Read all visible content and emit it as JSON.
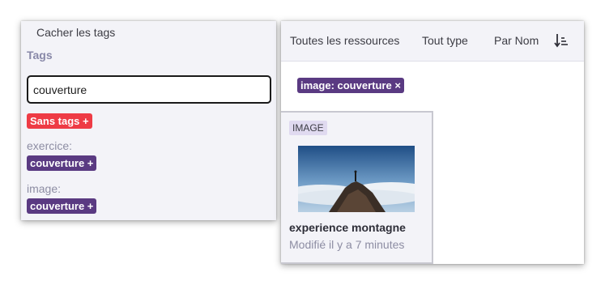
{
  "left_panel": {
    "hide_tags_label": "Cacher les tags",
    "tags_title": "Tags",
    "search_value": "couverture",
    "no_tags_label": "Sans tags +",
    "groups": [
      {
        "category": "exercice:",
        "tag": "couverture +"
      },
      {
        "category": "image:",
        "tag": "couverture +"
      }
    ]
  },
  "right_panel": {
    "toolbar": {
      "all_resources": "Toutes les ressources",
      "type": "Tout type",
      "sort": "Par Nom",
      "sort_icon": "sort-ascending-icon"
    },
    "active_filter": "image: couverture ×",
    "card": {
      "badge": "IMAGE",
      "title": "experience montagne",
      "modified": "Modifié il y a 7 minutes"
    }
  },
  "colors": {
    "tag_red": "#ee3b45",
    "tag_purple": "#5a3a82",
    "panel_bg": "#f3f3f8",
    "muted_text": "#8d8da3"
  }
}
